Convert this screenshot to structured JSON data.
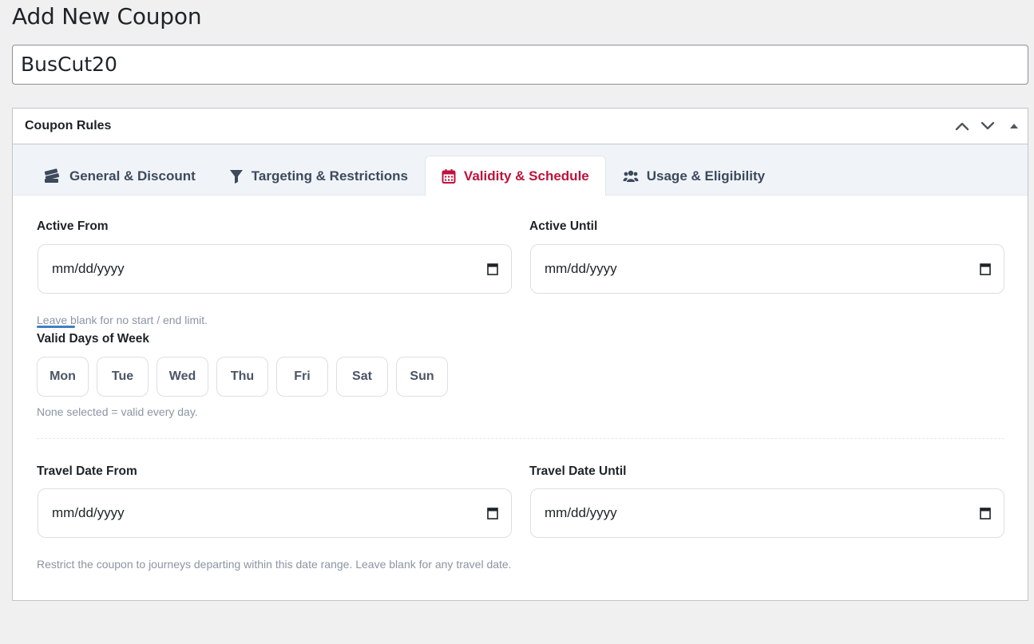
{
  "page": {
    "title": "Add New Coupon"
  },
  "coupon": {
    "name": "BusCut20"
  },
  "metabox": {
    "title": "Coupon Rules"
  },
  "tabs": [
    {
      "label": "General & Discount",
      "icon": "ticket-icon"
    },
    {
      "label": "Targeting & Restrictions",
      "icon": "filter-icon"
    },
    {
      "label": "Validity & Schedule",
      "icon": "calendar-icon",
      "active": true
    },
    {
      "label": "Usage & Eligibility",
      "icon": "users-icon"
    }
  ],
  "validity": {
    "active_from_label": "Active From",
    "active_from_value": "mm/dd/yyyy",
    "active_until_label": "Active Until",
    "active_until_value": "mm/dd/yyyy",
    "date_help": "Leave blank for no start / end limit.",
    "days_label": "Valid Days of Week",
    "days": [
      "Mon",
      "Tue",
      "Wed",
      "Thu",
      "Fri",
      "Sat",
      "Sun"
    ],
    "days_help": "None selected = valid every day.",
    "travel_from_label": "Travel Date From",
    "travel_from_value": "mm/dd/yyyy",
    "travel_until_label": "Travel Date Until",
    "travel_until_value": "mm/dd/yyyy",
    "travel_help": "Restrict the coupon to journeys departing within this date range. Leave blank for any travel date."
  },
  "colors": {
    "accent": "#be123c",
    "tab_text": "#3c4a5c",
    "help_text": "#8b95a3",
    "background": "#f0f0f1"
  }
}
